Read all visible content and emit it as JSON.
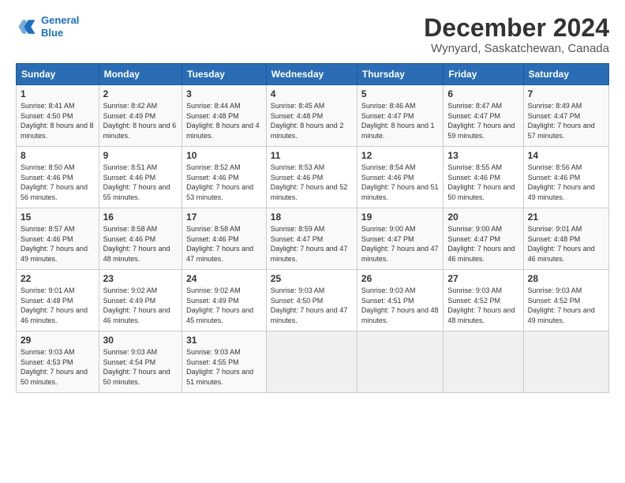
{
  "logo": {
    "line1": "General",
    "line2": "Blue"
  },
  "title": "December 2024",
  "subtitle": "Wynyard, Saskatchewan, Canada",
  "headers": [
    "Sunday",
    "Monday",
    "Tuesday",
    "Wednesday",
    "Thursday",
    "Friday",
    "Saturday"
  ],
  "weeks": [
    [
      {
        "day": "1",
        "sunrise": "8:41 AM",
        "sunset": "4:50 PM",
        "daylight": "8 hours and 8 minutes."
      },
      {
        "day": "2",
        "sunrise": "8:42 AM",
        "sunset": "4:49 PM",
        "daylight": "8 hours and 6 minutes."
      },
      {
        "day": "3",
        "sunrise": "8:44 AM",
        "sunset": "4:48 PM",
        "daylight": "8 hours and 4 minutes."
      },
      {
        "day": "4",
        "sunrise": "8:45 AM",
        "sunset": "4:48 PM",
        "daylight": "8 hours and 2 minutes."
      },
      {
        "day": "5",
        "sunrise": "8:46 AM",
        "sunset": "4:47 PM",
        "daylight": "8 hours and 1 minute."
      },
      {
        "day": "6",
        "sunrise": "8:47 AM",
        "sunset": "4:47 PM",
        "daylight": "7 hours and 59 minutes."
      },
      {
        "day": "7",
        "sunrise": "8:49 AM",
        "sunset": "4:47 PM",
        "daylight": "7 hours and 57 minutes."
      }
    ],
    [
      {
        "day": "8",
        "sunrise": "8:50 AM",
        "sunset": "4:46 PM",
        "daylight": "7 hours and 56 minutes."
      },
      {
        "day": "9",
        "sunrise": "8:51 AM",
        "sunset": "4:46 PM",
        "daylight": "7 hours and 55 minutes."
      },
      {
        "day": "10",
        "sunrise": "8:52 AM",
        "sunset": "4:46 PM",
        "daylight": "7 hours and 53 minutes."
      },
      {
        "day": "11",
        "sunrise": "8:53 AM",
        "sunset": "4:46 PM",
        "daylight": "7 hours and 52 minutes."
      },
      {
        "day": "12",
        "sunrise": "8:54 AM",
        "sunset": "4:46 PM",
        "daylight": "7 hours and 51 minutes."
      },
      {
        "day": "13",
        "sunrise": "8:55 AM",
        "sunset": "4:46 PM",
        "daylight": "7 hours and 50 minutes."
      },
      {
        "day": "14",
        "sunrise": "8:56 AM",
        "sunset": "4:46 PM",
        "daylight": "7 hours and 49 minutes."
      }
    ],
    [
      {
        "day": "15",
        "sunrise": "8:57 AM",
        "sunset": "4:46 PM",
        "daylight": "7 hours and 49 minutes."
      },
      {
        "day": "16",
        "sunrise": "8:58 AM",
        "sunset": "4:46 PM",
        "daylight": "7 hours and 48 minutes."
      },
      {
        "day": "17",
        "sunrise": "8:58 AM",
        "sunset": "4:46 PM",
        "daylight": "7 hours and 47 minutes."
      },
      {
        "day": "18",
        "sunrise": "8:59 AM",
        "sunset": "4:47 PM",
        "daylight": "7 hours and 47 minutes."
      },
      {
        "day": "19",
        "sunrise": "9:00 AM",
        "sunset": "4:47 PM",
        "daylight": "7 hours and 47 minutes."
      },
      {
        "day": "20",
        "sunrise": "9:00 AM",
        "sunset": "4:47 PM",
        "daylight": "7 hours and 46 minutes."
      },
      {
        "day": "21",
        "sunrise": "9:01 AM",
        "sunset": "4:48 PM",
        "daylight": "7 hours and 46 minutes."
      }
    ],
    [
      {
        "day": "22",
        "sunrise": "9:01 AM",
        "sunset": "4:48 PM",
        "daylight": "7 hours and 46 minutes."
      },
      {
        "day": "23",
        "sunrise": "9:02 AM",
        "sunset": "4:49 PM",
        "daylight": "7 hours and 46 minutes."
      },
      {
        "day": "24",
        "sunrise": "9:02 AM",
        "sunset": "4:49 PM",
        "daylight": "7 hours and 45 minutes."
      },
      {
        "day": "25",
        "sunrise": "9:03 AM",
        "sunset": "4:50 PM",
        "daylight": "7 hours and 47 minutes."
      },
      {
        "day": "26",
        "sunrise": "9:03 AM",
        "sunset": "4:51 PM",
        "daylight": "7 hours and 48 minutes."
      },
      {
        "day": "27",
        "sunrise": "9:03 AM",
        "sunset": "4:52 PM",
        "daylight": "7 hours and 48 minutes."
      },
      {
        "day": "28",
        "sunrise": "9:03 AM",
        "sunset": "4:52 PM",
        "daylight": "7 hours and 49 minutes."
      }
    ],
    [
      {
        "day": "29",
        "sunrise": "9:03 AM",
        "sunset": "4:53 PM",
        "daylight": "7 hours and 50 minutes."
      },
      {
        "day": "30",
        "sunrise": "9:03 AM",
        "sunset": "4:54 PM",
        "daylight": "7 hours and 50 minutes."
      },
      {
        "day": "31",
        "sunrise": "9:03 AM",
        "sunset": "4:55 PM",
        "daylight": "7 hours and 51 minutes."
      },
      null,
      null,
      null,
      null
    ]
  ]
}
